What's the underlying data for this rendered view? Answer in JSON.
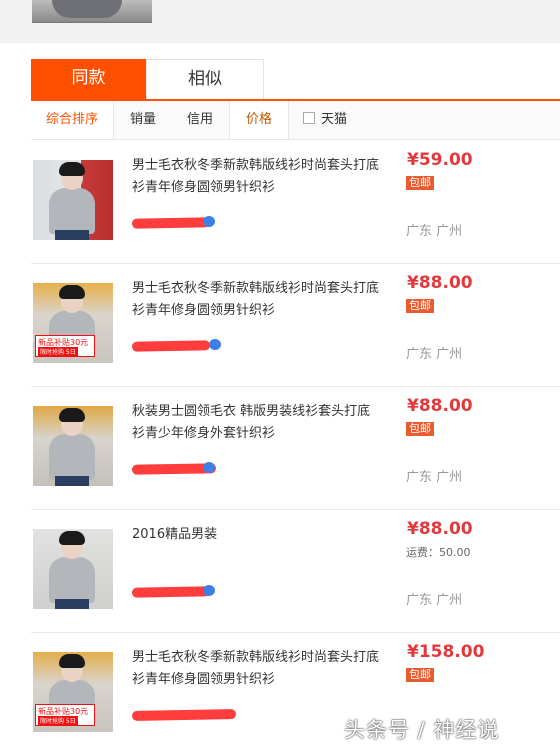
{
  "tabs": {
    "same": "同款",
    "similar": "相似"
  },
  "sort": {
    "overall": "综合排序",
    "sales": "销量",
    "credit": "信用",
    "price": "价格",
    "tmall": "天猫"
  },
  "items": [
    {
      "title": "男士毛衣秋冬季新款韩版线衫时尚套头打底衫青年修身圆领男针织衫",
      "price": "¥59.00",
      "tag": "包邮",
      "location": "广东 广州"
    },
    {
      "title": "男士毛衣秋冬季新款韩版线衫时尚套头打底衫青年修身圆领男针织衫",
      "price": "¥88.00",
      "tag": "包邮",
      "location": "广东 广州",
      "promo_1": "新品补贴30元",
      "promo_2": "限时抢购 5日"
    },
    {
      "title": "秋装男士圆领毛衣 韩版男装线衫套头打底衫青少年修身外套针织衫",
      "price": "¥88.00",
      "tag": "包邮",
      "location": "广东 广州"
    },
    {
      "title": "2016精品男装",
      "price": "¥88.00",
      "shipping": "运费：50.00",
      "location": "广东 广州"
    },
    {
      "title": "男士毛衣秋冬季新款韩版线衫时尚套头打底衫青年修身圆领男针织衫",
      "price": "¥158.00",
      "tag": "包邮",
      "promo_1": "新品补贴30元",
      "promo_2": "限时抢购 5日"
    }
  ],
  "watermark": "头条号 / 神经说",
  "colors": {
    "accent": "#ff5000",
    "price": "#e4393c",
    "tag_bg": "#e85b30"
  }
}
